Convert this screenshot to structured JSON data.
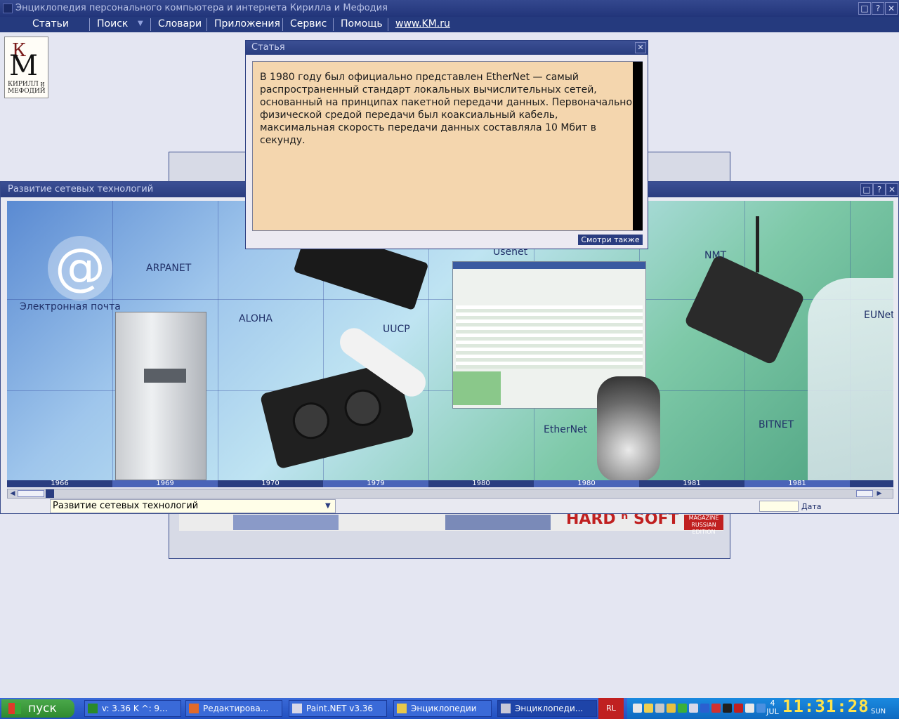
{
  "window": {
    "title": "Энциклопедия персонального компьютера и интернета Кирилла и Мефодия",
    "buttons": [
      "□",
      "?",
      "✕"
    ]
  },
  "menu": {
    "items": [
      "Статьи",
      "Поиск",
      "Словари",
      "Приложения",
      "Сервис",
      "Помощь",
      "www.KM.ru"
    ]
  },
  "logo": {
    "line1": "КИРИЛЛ и",
    "line2": "МЕФОДИЙ"
  },
  "article": {
    "title": "Статья",
    "text": "В 1980 году был официально представлен EtherNet — самый распространенный стандарт локальных вычислительных сетей, основанный на принципах пакетной передачи данных. Первоначально физической средой передачи был коаксиальный кабель, максимальная скорость передачи данных составляла 10 Мбит в секунду.",
    "see_also": "Смотри также",
    "close": "✕"
  },
  "main": {
    "title": "Развитие сетевых технологий",
    "labels": {
      "email": "Электронная почта",
      "arpanet": "ARPANET",
      "aloha": "ALOHA",
      "uucp": "UUCP",
      "usenet": "Usenet",
      "ethernet": "EtherNet",
      "nmt": "NMT",
      "eunet": "EUNet",
      "bitnet": "BITNET"
    },
    "years": [
      "1966",
      "1969",
      "1970",
      "1979",
      "1980",
      "1980",
      "1981",
      "1981"
    ],
    "combo_value": "Развитие сетевых технологий",
    "date_label": "Дата"
  },
  "taskbar": {
    "start": "пуск",
    "tasks": [
      "v: 3.36 K ^: 9...",
      "Редактирова...",
      "Paint.NET v3.36",
      "Энциклопедии",
      "Энциклопеди..."
    ],
    "lang": "RL",
    "date_day": "4",
    "date_month": "JUL",
    "time": "11:31:28",
    "weekday": "SUN"
  }
}
